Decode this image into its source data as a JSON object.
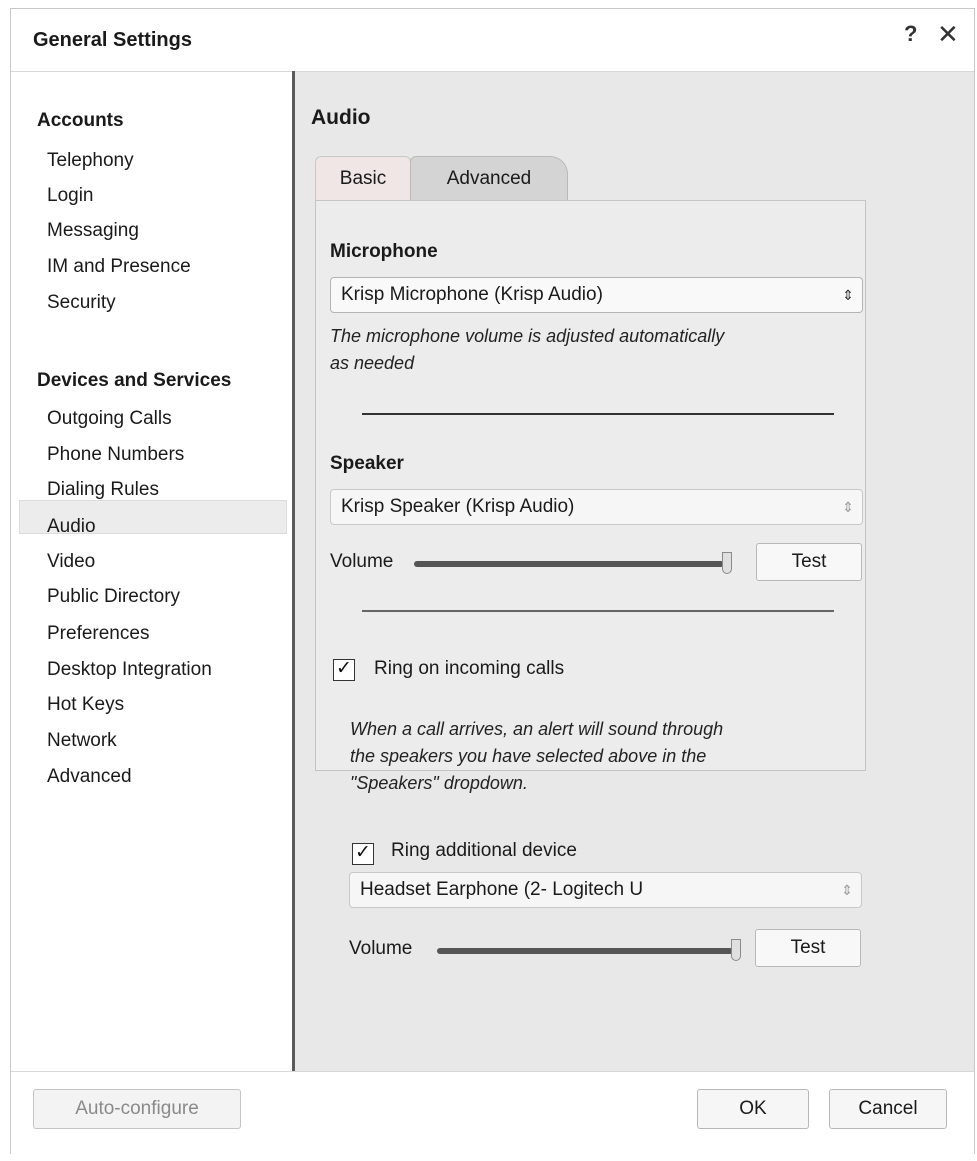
{
  "window": {
    "title": "General Settings",
    "help_glyph": "?",
    "close_glyph": "✕"
  },
  "sidebar": {
    "sections": [
      {
        "heading": "Accounts",
        "items": [
          "Telephony",
          "Login",
          "Messaging",
          "IM and Presence",
          "Security"
        ]
      },
      {
        "heading": "Devices and Services",
        "items": [
          "Outgoing Calls",
          "Phone Numbers",
          "Dialing Rules",
          "Audio",
          "Video",
          "Public Directory",
          "Preferences",
          "Desktop Integration",
          "Hot Keys",
          "Network",
          "Advanced"
        ]
      }
    ],
    "selected": "Audio"
  },
  "content": {
    "title": "Audio",
    "tabs": [
      {
        "label": "Basic",
        "active": false
      },
      {
        "label": "Advanced",
        "active": true
      }
    ],
    "microphone": {
      "label": "Microphone",
      "selected": "Krisp Microphone (Krisp Audio)",
      "note_line1": "The microphone volume is adjusted automatically",
      "note_line2": "as needed"
    },
    "speaker": {
      "label": "Speaker",
      "selected": "Krisp Speaker (Krisp Audio)",
      "volume_label": "Volume",
      "volume_level": 1.0,
      "test_label": "Test"
    },
    "ring": {
      "checkbox_label": "Ring on incoming calls",
      "checked": true,
      "note_line1": "When a call arrives, an alert will sound through",
      "note_line2": "the speakers you have selected above in the",
      "note_line3": "\"Speakers\" dropdown."
    },
    "additional": {
      "checkbox_label": "Ring additional device",
      "checked": true,
      "selected": "Headset Earphone (2- Logitech U",
      "volume_label": "Volume",
      "volume_level": 1.0,
      "test_label": "Test"
    }
  },
  "footer": {
    "auto_configure": "Auto-configure",
    "ok": "OK",
    "cancel": "Cancel"
  },
  "icons": {
    "check": "✓",
    "updown": "⇕"
  }
}
